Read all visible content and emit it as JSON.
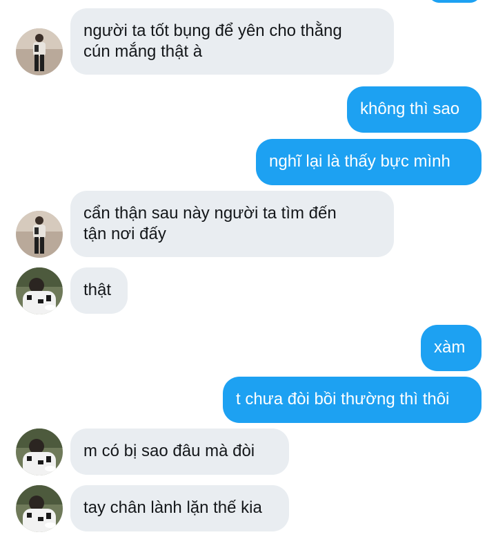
{
  "messages": [
    {
      "side": "incoming",
      "text": "người ta tốt bụng để yên cho thằng\ncún mắng thật à",
      "avatar": "avatar-1"
    },
    {
      "side": "outgoing",
      "text": "không thì sao"
    },
    {
      "side": "outgoing",
      "text": "nghĩ lại là thấy bực mình"
    },
    {
      "side": "incoming",
      "text": "cẩn thận sau này người ta tìm đến\ntận nơi đấy",
      "avatar": "avatar-1"
    },
    {
      "side": "incoming",
      "text": "thật",
      "avatar": "avatar-2"
    },
    {
      "side": "outgoing",
      "text": "xàm"
    },
    {
      "side": "outgoing",
      "text": "t chưa đòi bồi thường thì thôi"
    },
    {
      "side": "incoming",
      "text": "m có bị sao đâu mà đòi",
      "avatar": "avatar-2"
    },
    {
      "side": "incoming",
      "text": "tay chân lành lặn thế kia",
      "avatar": "avatar-2"
    }
  ],
  "colors": {
    "outgoing_bubble": "#1da1f2",
    "incoming_bubble": "#e9edf1",
    "incoming_text": "#14171a",
    "outgoing_text": "#ffffff"
  }
}
